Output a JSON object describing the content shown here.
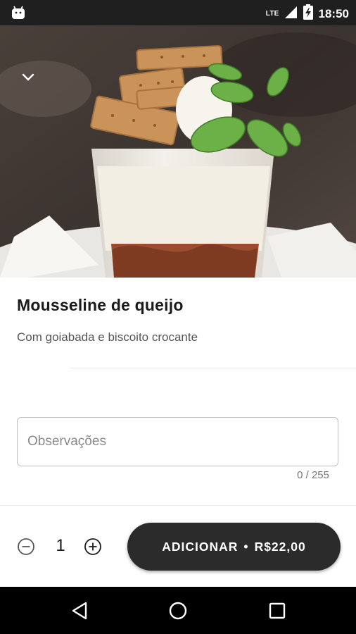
{
  "status_bar": {
    "time": "18:50",
    "network": "LTE",
    "icons": [
      "android-icon",
      "lte-signal-icon",
      "battery-charging-icon"
    ]
  },
  "product": {
    "name": "Mousseline de queijo",
    "description": "Com goiabada e biscoito crocante"
  },
  "notes": {
    "placeholder": "Observações",
    "value": "",
    "counter": "0 / 255"
  },
  "order": {
    "quantity": "1",
    "add_label": "ADICIONAR",
    "separator": "•",
    "price": "R$22,00"
  },
  "colors": {
    "button_bg": "#2b2b2b",
    "status_bar": "#1f1f1f",
    "nav_bar": "#000000",
    "title_text": "#1a1a1a"
  },
  "nav": {
    "icons": [
      "back-triangle-icon",
      "home-circle-icon",
      "recent-apps-square-icon"
    ]
  }
}
